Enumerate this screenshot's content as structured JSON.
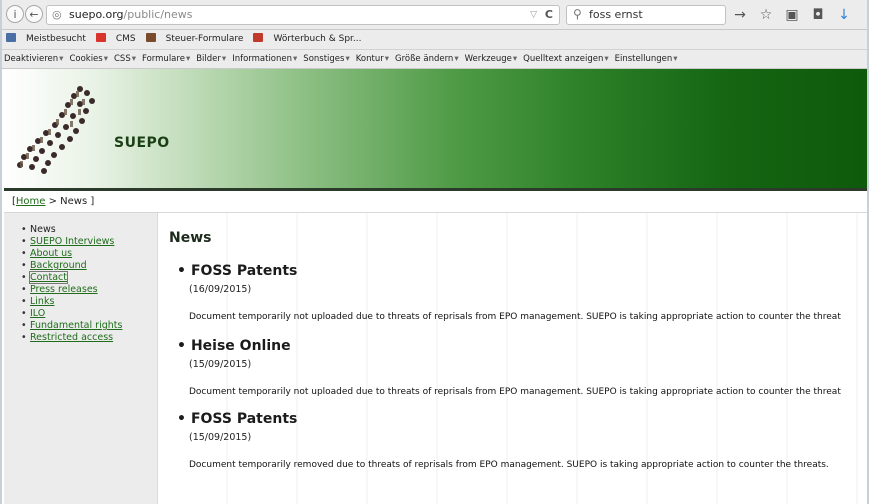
{
  "browser": {
    "url_host": "suepo.org",
    "url_path": "/public/news",
    "search_value": "foss ernst"
  },
  "bookmarks": [
    {
      "label": "Meistbesucht",
      "color": "#4a6fa5"
    },
    {
      "label": "CMS",
      "color": "#d9342b"
    },
    {
      "label": "Steuer-Formulare",
      "color": "#7a4b2a"
    },
    {
      "label": "Wörterbuch & Spr...",
      "color": "#c0392b"
    }
  ],
  "devbar": [
    "Deaktivieren",
    "Cookies",
    "CSS",
    "Formulare",
    "Bilder",
    "Informationen",
    "Sonstiges",
    "Kontur",
    "Größe ändern",
    "Werkzeuge",
    "Quelltext anzeigen",
    "Einstellungen"
  ],
  "banner": {
    "title": "SUEPO"
  },
  "breadcrumb": {
    "open": "[",
    "home": "Home",
    "rest": " > News ]"
  },
  "sidebar": {
    "items": [
      {
        "label": "News",
        "link": false
      },
      {
        "label": "SUEPO Interviews",
        "link": true
      },
      {
        "label": "About us",
        "link": true
      },
      {
        "label": "Background",
        "link": true
      },
      {
        "label": "Contact",
        "link": true
      },
      {
        "label": "Press releases",
        "link": true
      },
      {
        "label": "Links",
        "link": true
      },
      {
        "label": "ILO",
        "link": true
      },
      {
        "label": "Fundamental rights",
        "link": true
      },
      {
        "label": "Restricted access",
        "link": true
      }
    ]
  },
  "main": {
    "heading": "News",
    "items": [
      {
        "title": "FOSS Patents",
        "date": "(16/09/2015)",
        "text": "Document temporarily not uploaded due to threats of reprisals from EPO management. SUEPO is taking appropriate action to counter the threat"
      },
      {
        "title": "Heise Online",
        "date": "(15/09/2015)",
        "text": "Document temporarily not uploaded due to threats of reprisals from EPO management. SUEPO is taking appropriate action to counter the threat"
      },
      {
        "title": "FOSS Patents",
        "date": "(15/09/2015)",
        "text": "Document temporarily removed due to threats of reprisals from EPO management. SUEPO is taking appropriate action to counter the threats."
      }
    ]
  }
}
